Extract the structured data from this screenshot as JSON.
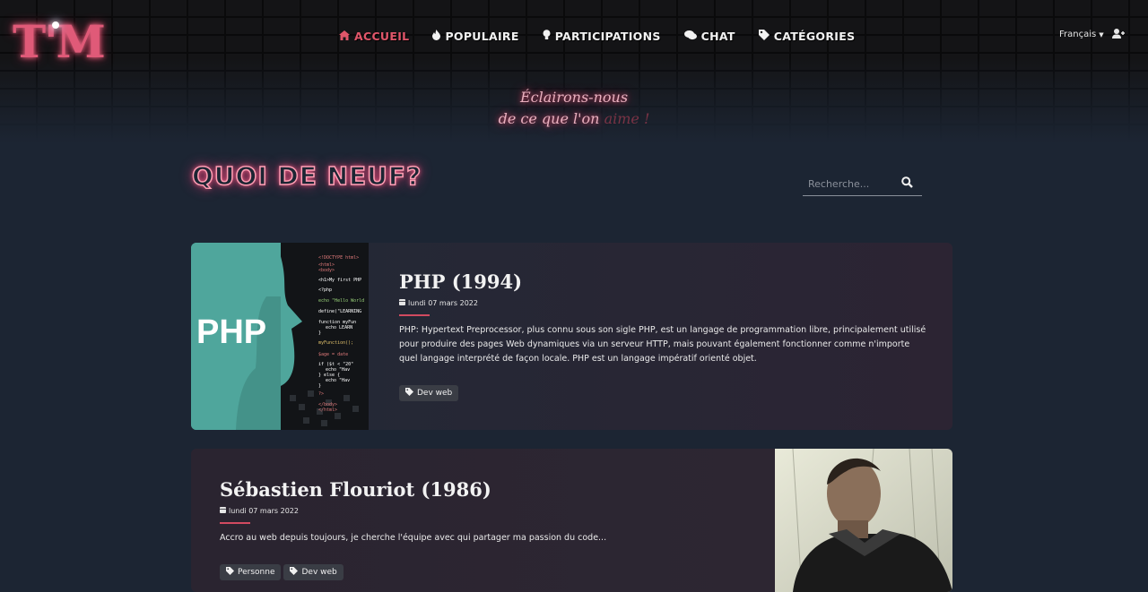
{
  "brand": {
    "logo_text": "T'M"
  },
  "nav": {
    "items": [
      {
        "label": "ACCUEIL",
        "icon": "home-icon",
        "glyph": "⌂",
        "active": true
      },
      {
        "label": "POPULAIRE",
        "icon": "flame-icon",
        "glyph": "🔥",
        "active": false
      },
      {
        "label": "PARTICIPATIONS",
        "icon": "lightbulb-icon",
        "glyph": "💡",
        "active": false
      },
      {
        "label": "CHAT",
        "icon": "comments-icon",
        "glyph": "💬",
        "active": false
      },
      {
        "label": "CATÉGORIES",
        "icon": "tag-icon",
        "glyph": "🏷",
        "active": false
      }
    ],
    "language": "Français"
  },
  "tagline": {
    "line1": "Éclairons-nous",
    "line2_prefix": "de ce que l'on ",
    "line2_dim": "aime !"
  },
  "main": {
    "title": "QUOI DE NEUF?",
    "search_placeholder": "Recherche..."
  },
  "posts": [
    {
      "title": "PHP (1994)",
      "date": "lundi 07 mars 2022",
      "excerpt": "PHP: Hypertext Preprocessor, plus connu sous son sigle PHP, est un langage de programmation libre, principalement utilisé pour produire des pages Web dynamiques via un serveur HTTP, mais pouvant également fonctionner comme n'importe quel langage interprété de façon locale. PHP est un langage impératif orienté objet.",
      "tags": [
        "Dev web"
      ],
      "thumb_text": "PHP"
    },
    {
      "title": "Sébastien Flouriot (1986)",
      "date": "lundi 07 mars 2022",
      "excerpt": "Accro au web depuis toujours, je cherche l'équipe avec qui partager ma passion du code...",
      "tags": [
        "Personne",
        "Dev web"
      ]
    }
  ],
  "colors": {
    "accent": "#e0566a",
    "background": "#1c2533",
    "neon": "#ff5f88"
  }
}
